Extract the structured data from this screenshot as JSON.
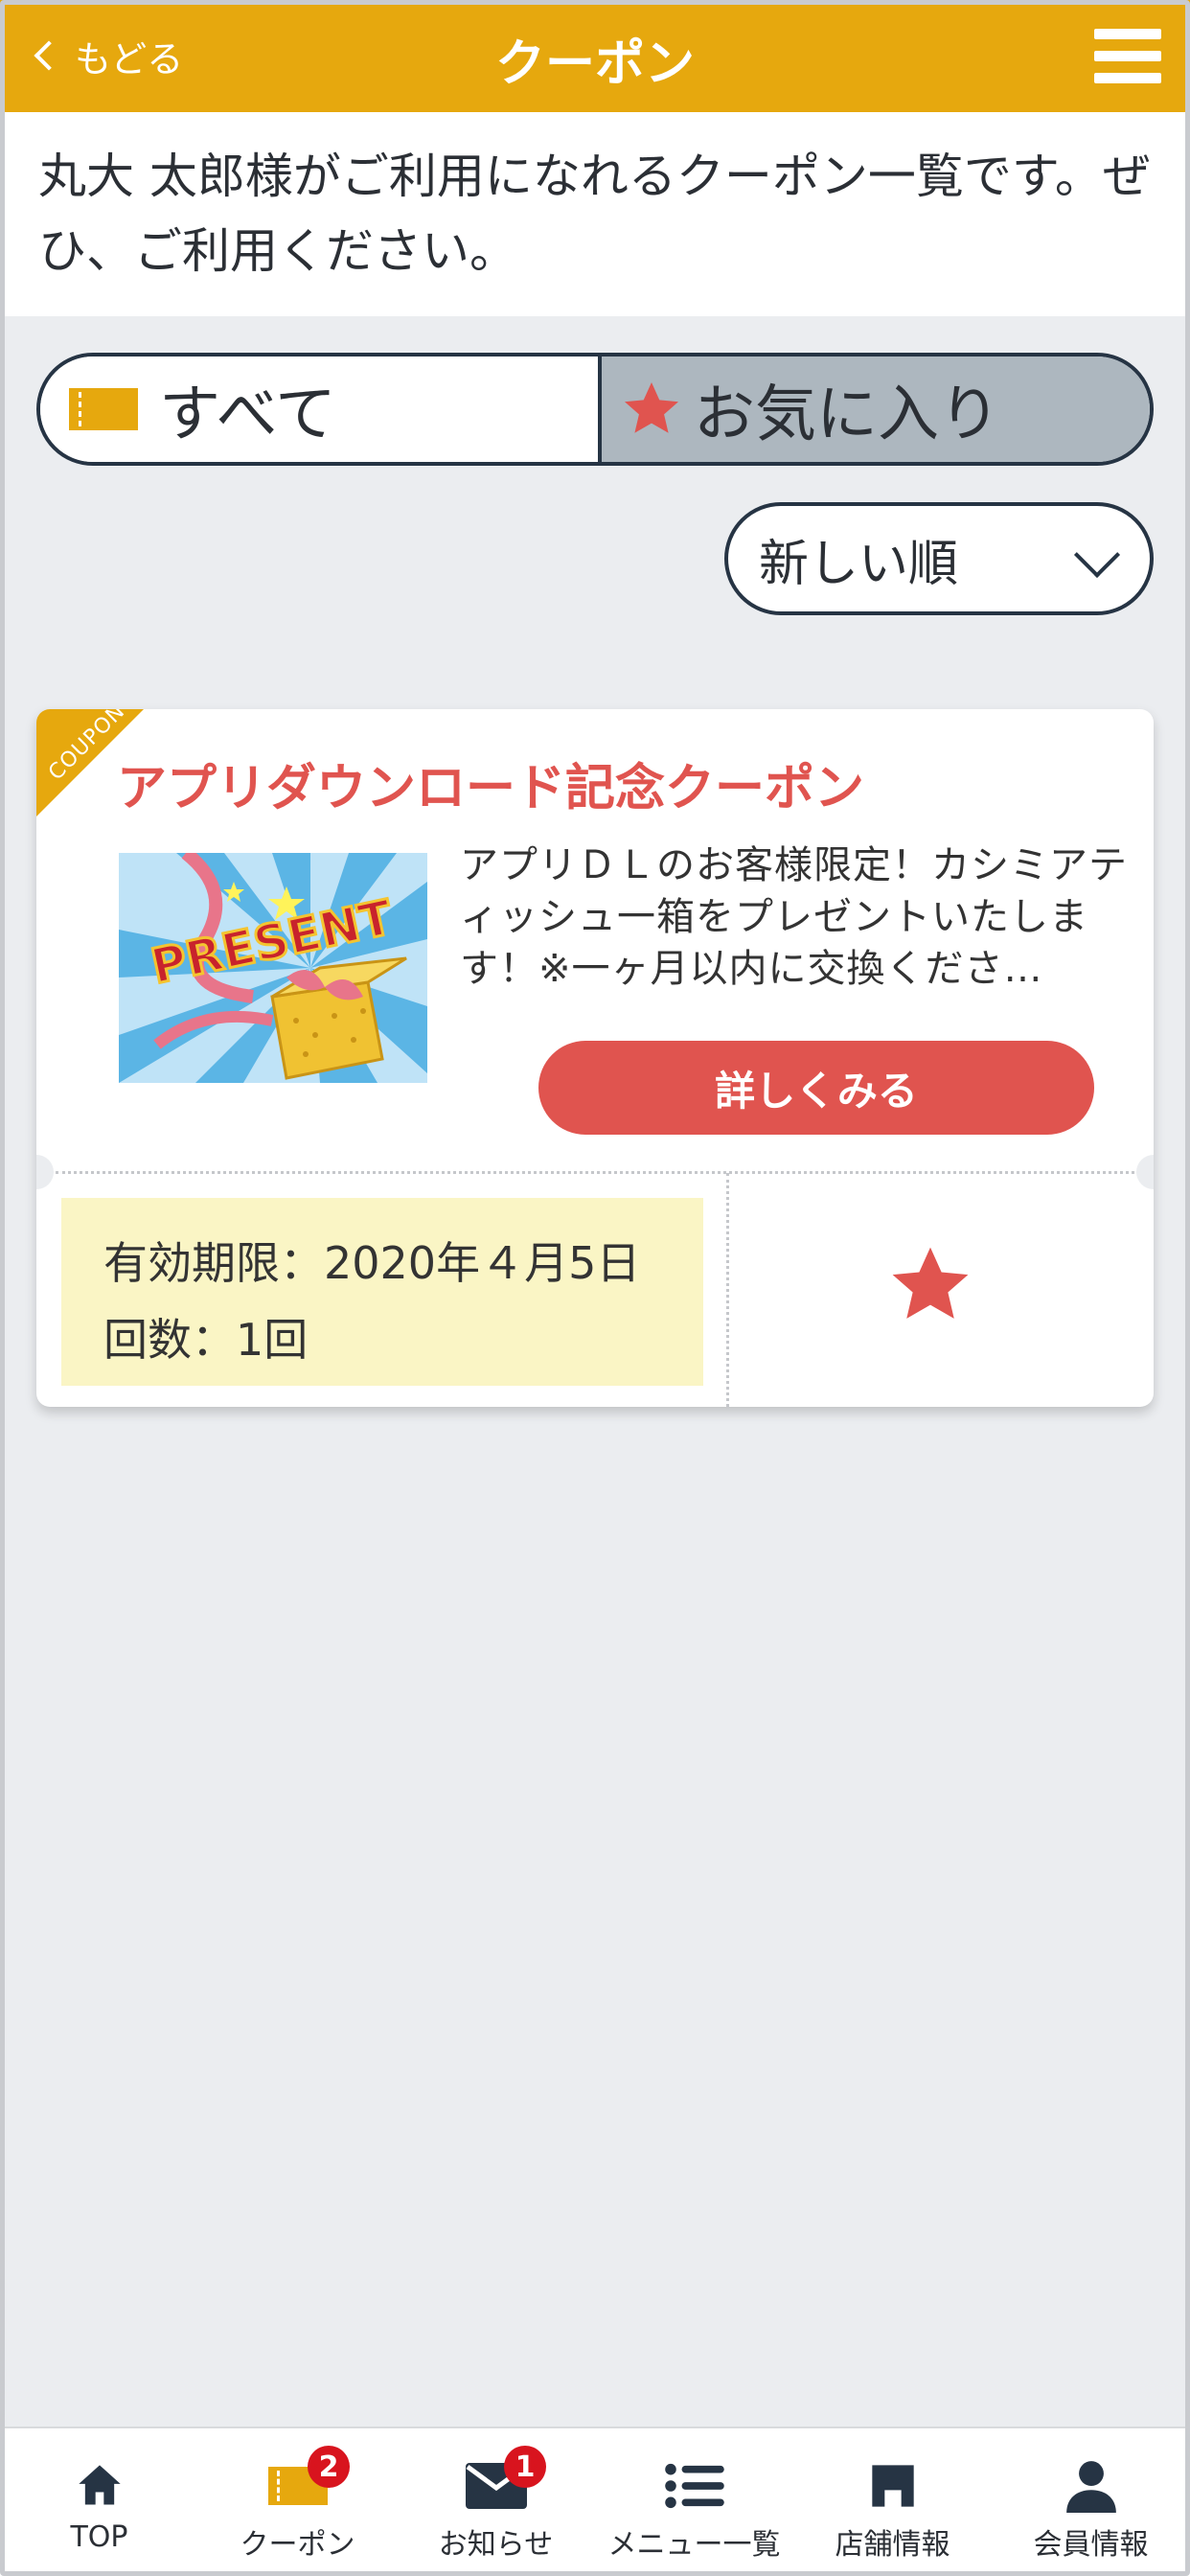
{
  "header": {
    "back_label": "もどる",
    "title": "クーポン"
  },
  "intro": {
    "text": "丸大 太郎様がご利用になれるクーポン一覧です。ぜひ、ご利用ください。"
  },
  "tabs": [
    {
      "label": "すべて",
      "icon": "ticket-icon"
    },
    {
      "label": "お気に入り",
      "icon": "star-icon"
    }
  ],
  "sort": {
    "selected": "新しい順"
  },
  "coupon": {
    "corner_label": "COUPON",
    "title": "アプリダウンロード記念クーポン",
    "image_text": "PRESENT",
    "description": "アプリＤＬのお客様限定！カシミアティッシュ一箱をプレゼントいたします！※一ヶ月以内に交換くださ…",
    "button_label": "詳しくみる",
    "validity": "有効期限：2020年４月5日",
    "count": "回数：1回"
  },
  "bottom_nav": [
    {
      "label": "TOP",
      "icon": "home-icon",
      "badge": ""
    },
    {
      "label": "クーポン",
      "icon": "ticket-icon",
      "badge": "2"
    },
    {
      "label": "お知らせ",
      "icon": "mail-icon",
      "badge": "1"
    },
    {
      "label": "メニュー一覧",
      "icon": "list-icon",
      "badge": ""
    },
    {
      "label": "店舗情報",
      "icon": "store-icon",
      "badge": ""
    },
    {
      "label": "会員情報",
      "icon": "person-icon",
      "badge": ""
    }
  ],
  "colors": {
    "accent": "#e6a80e",
    "coupon_red": "#e0544f",
    "badge_red": "#d8141e",
    "tab_active": "#adb7bf",
    "validity_bg": "#faf5c5"
  }
}
